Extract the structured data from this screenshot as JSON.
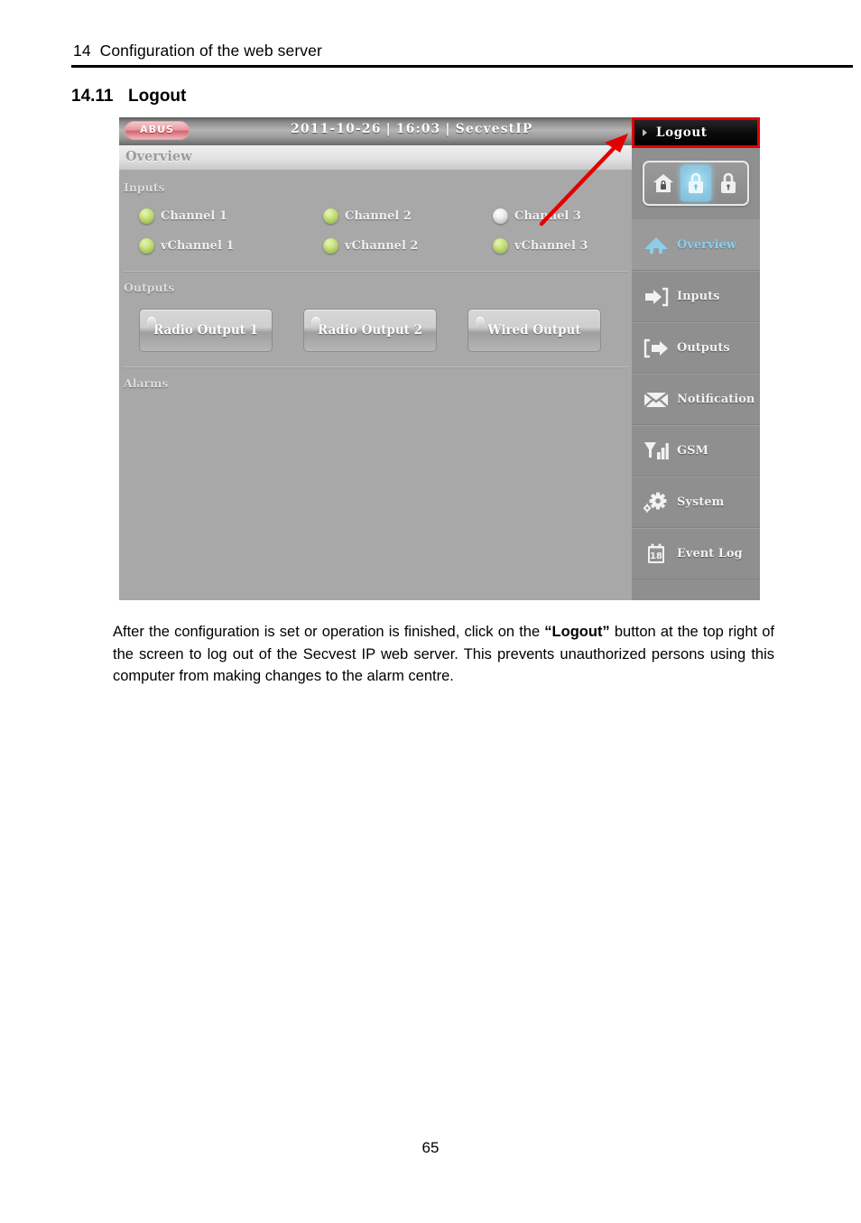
{
  "document": {
    "chapter_number": "14",
    "chapter_title": "Configuration of the web server",
    "section_number": "14.11",
    "section_title": "Logout",
    "page_number": "65",
    "body_paragraph_part1": "After the configuration is set or operation is finished, click on the ",
    "body_paragraph_bold": "“Logout”",
    "body_paragraph_part2": " button at the top right of the screen to log out of the Secvest IP web server. This prevents unauthorized persons using this computer from making changes to the alarm centre."
  },
  "screenshot": {
    "topbar": {
      "logo_text": "ABUS",
      "date": "2011-10-26",
      "separator": "|",
      "time": "16:03",
      "device_name": "SecvestIP",
      "logout_label": "Logout",
      "logout_highlight_color": "#e20000"
    },
    "page_title": "Overview",
    "groups": {
      "inputs_label": "Inputs",
      "outputs_label": "Outputs",
      "alarms_label": "Alarms"
    },
    "inputs": [
      {
        "label": "Channel 1",
        "state": "green"
      },
      {
        "label": "Channel 2",
        "state": "green"
      },
      {
        "label": "Channel 3",
        "state": "off"
      },
      {
        "label": "vChannel 1",
        "state": "green"
      },
      {
        "label": "vChannel 2",
        "state": "green"
      },
      {
        "label": "vChannel 3",
        "state": "green"
      }
    ],
    "outputs": [
      {
        "label": "Radio Output 1"
      },
      {
        "label": "Radio Output 2"
      },
      {
        "label": "Wired Output"
      }
    ],
    "arming": [
      {
        "name": "partial-arm",
        "icon": "house-lock-icon",
        "active": false
      },
      {
        "name": "disarm",
        "icon": "open-padlock-icon",
        "active": true
      },
      {
        "name": "arm",
        "icon": "closed-padlock-icon",
        "active": false
      }
    ],
    "nav": [
      {
        "label": "Overview",
        "icon": "home-icon",
        "active": true
      },
      {
        "label": "Inputs",
        "icon": "arrow-in-icon",
        "active": false
      },
      {
        "label": "Outputs",
        "icon": "arrow-out-icon",
        "active": false
      },
      {
        "label": "Notification",
        "icon": "envelope-icon",
        "active": false
      },
      {
        "label": "GSM",
        "icon": "signal-bars-icon",
        "active": false
      },
      {
        "label": "System",
        "icon": "gear-icon",
        "active": false
      },
      {
        "label": "Event Log",
        "icon": "calendar-icon",
        "active": false,
        "icon_text": "18"
      }
    ],
    "callout": {
      "arrow_color": "#e20000",
      "points_to": "Logout"
    },
    "colors": {
      "active_nav": "#8ccdea",
      "led_green": "#b5d66a",
      "sidebar_bg": "#8f8f8f",
      "main_bg": "#a8a8a8"
    }
  }
}
